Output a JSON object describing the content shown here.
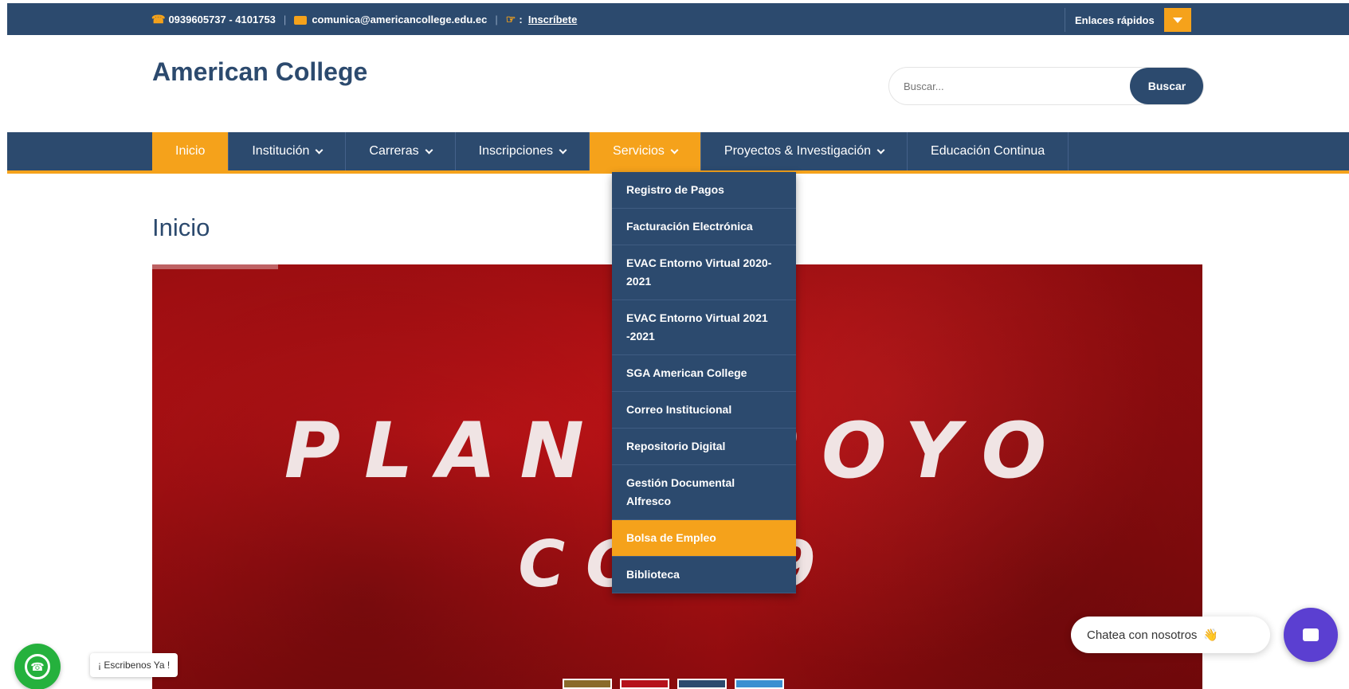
{
  "topbar": {
    "phone": "0939605737 - 4101753",
    "email": "comunica@americancollege.edu.ec",
    "inscribete": "Inscríbete",
    "hand_suffix": ":",
    "quick_links": "Enlaces rápidos"
  },
  "header": {
    "logo": "American College",
    "search_placeholder": "Buscar...",
    "search_button": "Buscar"
  },
  "nav": {
    "items": [
      {
        "label": "Inicio"
      },
      {
        "label": "Institución"
      },
      {
        "label": "Carreras"
      },
      {
        "label": "Inscripciones"
      },
      {
        "label": "Servicios"
      },
      {
        "label": "Proyectos & Investigación"
      },
      {
        "label": "Educación Continua"
      }
    ]
  },
  "dropdown": {
    "items": [
      {
        "label": "Registro de Pagos"
      },
      {
        "label": "Facturación Electrónica"
      },
      {
        "label": "EVAC Entorno Virtual 2020-2021"
      },
      {
        "label": "EVAC Entorno Virtual 2021 -2021"
      },
      {
        "label": "SGA American College"
      },
      {
        "label": "Correo Institucional"
      },
      {
        "label": "Repositorio Digital"
      },
      {
        "label": "Gestión Documental Alfresco"
      },
      {
        "label": "Bolsa de Empleo"
      },
      {
        "label": "Biblioteca"
      }
    ]
  },
  "main": {
    "title": "Inicio",
    "banner_line1": "PLAN   APOYO",
    "banner_line2": "COV    9"
  },
  "chat": {
    "bubble": "Chatea con nosotros",
    "emoji": "👋",
    "whatsapp_label": "¡ Escribenos Ya !"
  },
  "colors": {
    "primary": "#2c4a6e",
    "accent": "#f5a21b",
    "banner": "#b5121b",
    "chat": "#5b3fd1",
    "whatsapp": "#25b13d"
  }
}
